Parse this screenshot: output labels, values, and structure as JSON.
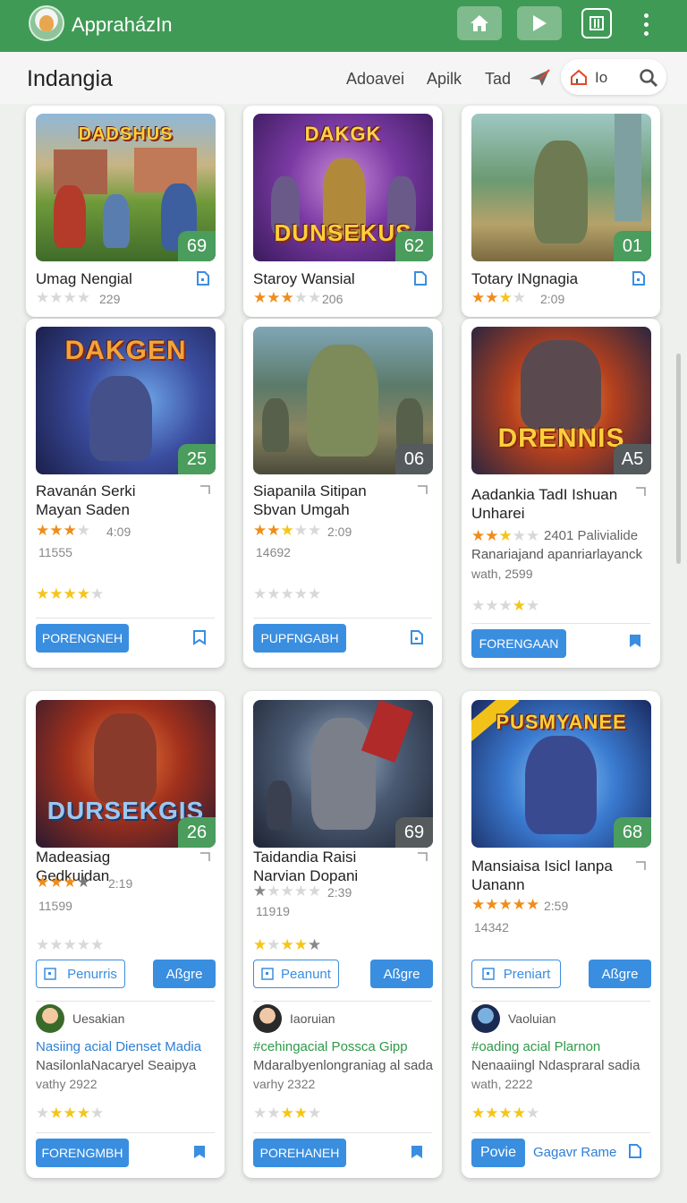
{
  "app": {
    "title": "AppraházIn"
  },
  "header": {
    "page_title": "Indangia",
    "nav": [
      "Adoavei",
      "Apilk",
      "Tad"
    ],
    "search_label": "Io"
  },
  "colors": {
    "appbar": "#3f9a55",
    "primary_button": "#3a8ee0",
    "score_badge": "#4a9d5c",
    "star": "#f08c18"
  },
  "row1": [
    {
      "title": "Umag Nengial",
      "score": "69",
      "meta": "229",
      "logo": "DADSHUS",
      "stars": 0
    },
    {
      "title": "Staroy Wansial",
      "score": "62",
      "meta": "206",
      "logo": "DUNSEKUS",
      "stars": 3
    },
    {
      "title": "Totary INgnagia",
      "score": "01",
      "meta": "2:09",
      "logo": "",
      "stars": 2.5
    }
  ],
  "row2": [
    {
      "title": "Ravanán Serki Mayan Saden",
      "score": "25",
      "meta": "4:09",
      "count": "11555",
      "logo": "DAKGEN",
      "stars": 3,
      "stars2": 4,
      "button": "PORENGNEH"
    },
    {
      "title": "Siapanila Sitipan Sbvan Umgah",
      "score": "06",
      "meta": "2:09",
      "count": "14692",
      "logo": "",
      "stars": 2.5,
      "stars2": 0,
      "button": "PUPFNGABH"
    },
    {
      "title": "Aadankia TadI Ishuan Unharei",
      "score": "A5",
      "meta": "2401 Palivialide",
      "desc1": "Ranariajand apanriarlayanck",
      "desc2": "wath, 2599",
      "logo": "DRENNIS",
      "stars": 2.5,
      "stars2": 3,
      "button": "FORENGAAN"
    }
  ],
  "row3": [
    {
      "title": "Madeasiag Gedkuidan",
      "score": "26",
      "meta": "2:19",
      "count": "11599",
      "logo": "DURSEKGIS",
      "stars": 3,
      "stars2": 0,
      "btn_outline": "Penurris",
      "btn_fill": "Aßgre",
      "author": "Uesakian",
      "promo": "Nasiing acial Dienset Madia",
      "desc1": "NasilonlaNacaryel Seaipya",
      "desc2": "vathy 2922",
      "stars3": 3,
      "button": "FORENGMBH"
    },
    {
      "title": "Taidandia Raisi Narvian Dopani",
      "score": "69",
      "meta": "2:39",
      "count": "11919",
      "logo": "",
      "stars": 1,
      "stars2": 3,
      "btn_outline": "Peanunt",
      "btn_fill": "Aßgre",
      "author": "Iaoruian",
      "promo": "#cehingacial Possca Gipp",
      "desc1": "Mdaralbyenlongraniag al sada",
      "desc2": "varhy 2322",
      "stars3": 3,
      "button": "POREHANEH"
    },
    {
      "title": "Mansiaisa Isicl Ianpa Uanann",
      "score": "68",
      "meta": "2:59",
      "count": "14342",
      "logo": "PUSMYANEE",
      "stars": 5,
      "stars2": 0,
      "btn_outline": "Preniart",
      "btn_fill": "Aßgre",
      "author": "Vaoluian",
      "promo": "#oading acial Plarnon",
      "desc1": "Nenaaiingl Ndaspraral sadia",
      "desc2": "wath, 2222",
      "stars3": 4,
      "button": "Povie",
      "link": "Gagavr Rame"
    }
  ]
}
